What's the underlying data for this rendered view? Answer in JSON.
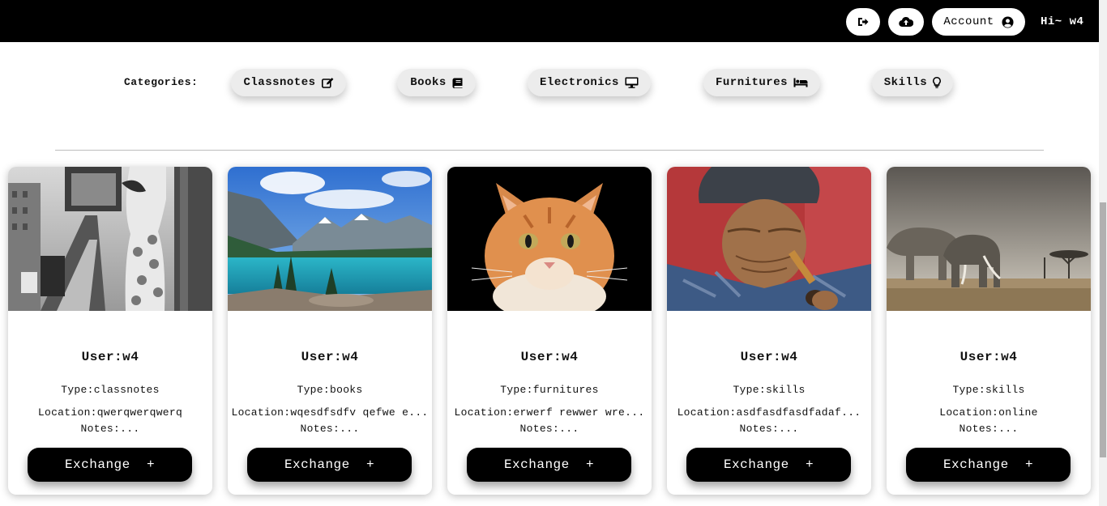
{
  "header": {
    "logout_icon": "sign-out-icon",
    "upload_icon": "cloud-upload-icon",
    "account_label": "Account",
    "account_icon": "user-circle-icon",
    "greeting": "Hi~ w4"
  },
  "categories": {
    "label": "Categories:",
    "items": [
      {
        "label": "Classnotes",
        "icon": "edit-icon"
      },
      {
        "label": "Books",
        "icon": "book-icon"
      },
      {
        "label": "Electronics",
        "icon": "desktop-icon"
      },
      {
        "label": "Furnitures",
        "icon": "bed-icon"
      },
      {
        "label": "Skills",
        "icon": "lightbulb-icon"
      }
    ]
  },
  "cards": [
    {
      "user": "User:w4",
      "type_label": "Type:",
      "type_value": "classnotes",
      "location_label": "Location:",
      "location_value": "qwerqwerqwerq",
      "notes": "Notes:...",
      "button": "Exchange  +"
    },
    {
      "user": "User:w4",
      "type_label": "Type:",
      "type_value": "books",
      "location_label": "Location:",
      "location_value": "wqesdfsdfv qefwe e...",
      "notes": "Notes:...",
      "button": "Exchange  +"
    },
    {
      "user": "User:w4",
      "type_label": "Type:",
      "type_value": "furnitures",
      "location_label": "Location:",
      "location_value": "erwerf rewwer wre...",
      "notes": "Notes:...",
      "button": "Exchange  +"
    },
    {
      "user": "User:w4",
      "type_label": "Type:",
      "type_value": "skills",
      "location_label": "Location:",
      "location_value": "asdfasdfasdfadaf...",
      "notes": "Notes:...",
      "button": "Exchange  +"
    },
    {
      "user": "User:w4",
      "type_label": "Type:",
      "type_value": "skills",
      "location_label": "Location:",
      "location_value": "online",
      "notes": "Notes:...",
      "button": "Exchange  +"
    }
  ]
}
